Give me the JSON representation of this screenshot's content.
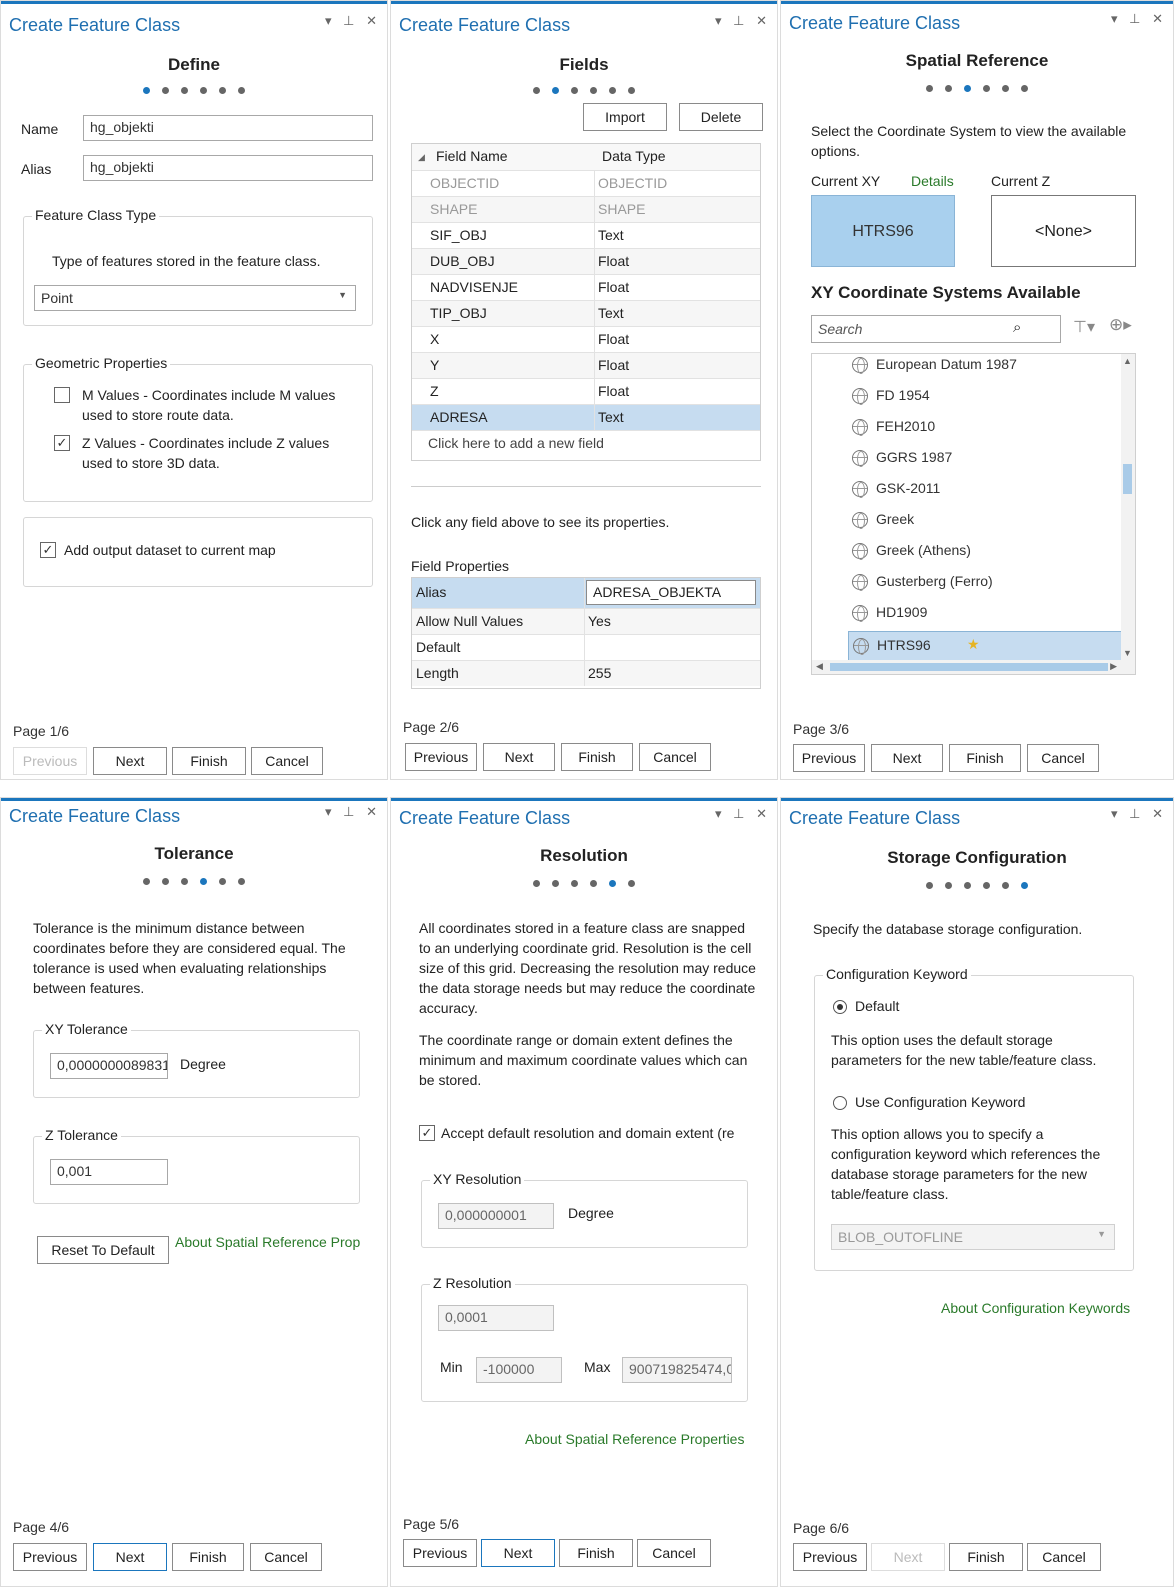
{
  "common": {
    "window_title": "Create Feature Class",
    "pane_controls": "▾ ⊥ ✕",
    "buttons": {
      "previous": "Previous",
      "next": "Next",
      "finish": "Finish",
      "cancel": "Cancel"
    }
  },
  "define": {
    "step": "Define",
    "page": "Page 1/6",
    "name_label": "Name",
    "name_value": "hg_objekti",
    "alias_label": "Alias",
    "alias_value": "hg_objekti",
    "type_group": "Feature Class Type",
    "type_desc": "Type of features stored in the feature class.",
    "type_value": "Point",
    "geom_group": "Geometric Properties",
    "m_values": "M Values - Coordinates include M values used to store route data.",
    "m_checked": false,
    "z_values": "Z Values - Coordinates include Z values used to store 3D data.",
    "z_checked": true,
    "add_output": "Add output dataset to current map",
    "add_checked": true
  },
  "fields": {
    "step": "Fields",
    "page": "Page 2/6",
    "import_btn": "Import",
    "delete_btn": "Delete",
    "col_name": "Field Name",
    "col_type": "Data Type",
    "rows": [
      {
        "name": "OBJECTID",
        "type": "OBJECTID"
      },
      {
        "name": "SHAPE",
        "type": "SHAPE"
      },
      {
        "name": "SIF_OBJ",
        "type": "Text"
      },
      {
        "name": "DUB_OBJ",
        "type": "Float"
      },
      {
        "name": "NADVISENJE",
        "type": "Float"
      },
      {
        "name": "TIP_OBJ",
        "type": "Text"
      },
      {
        "name": "X",
        "type": "Float"
      },
      {
        "name": "Y",
        "type": "Float"
      },
      {
        "name": "Z",
        "type": "Float"
      },
      {
        "name": "ADRESA",
        "type": "Text"
      }
    ],
    "add_field": "Click here to add a new field",
    "hint": "Click any field above to see its properties.",
    "props_title": "Field Properties",
    "props": [
      {
        "key": "Alias",
        "value": "ADRESA_OBJEKTA"
      },
      {
        "key": "Allow Null Values",
        "value": "Yes"
      },
      {
        "key": "Default",
        "value": ""
      },
      {
        "key": "Length",
        "value": "255"
      }
    ]
  },
  "spatial": {
    "step": "Spatial Reference",
    "page": "Page 3/6",
    "desc": "Select the Coordinate System to view the available options.",
    "current_xy": "Current XY",
    "details": "Details",
    "current_z": "Current Z",
    "xy_value": "HTRS96",
    "z_value": "<None>",
    "available": "XY Coordinate Systems Available",
    "search_placeholder": "Search",
    "systems": [
      "European Datum 1987",
      "FD 1954",
      "FEH2010",
      "GGRS 1987",
      "GSK-2011",
      "Greek",
      "Greek (Athens)",
      "Gusterberg (Ferro)",
      "HD1909",
      "HTRS96"
    ]
  },
  "tolerance": {
    "step": "Tolerance",
    "page": "Page 4/6",
    "desc": "Tolerance is the minimum distance between coordinates before they are considered equal. The tolerance is used when evaluating relationships between features.",
    "xy_group": "XY Tolerance",
    "xy_value": "0,0000000089831",
    "xy_unit": "Degree",
    "z_group": "Z Tolerance",
    "z_value": "0,001",
    "reset": "Reset To Default",
    "about": "About Spatial Reference Prop"
  },
  "resolution": {
    "step": "Resolution",
    "page": "Page 5/6",
    "desc1": "All coordinates stored in a feature class are snapped to an underlying coordinate grid. Resolution is the cell size of this grid. Decreasing the resolution may reduce the data storage needs but may reduce the coordinate accuracy.",
    "desc2": "The coordinate range or domain extent defines the minimum and maximum coordinate values which can be stored.",
    "accept": "Accept default resolution and domain extent (re",
    "accept_checked": true,
    "xy_group": "XY Resolution",
    "xy_value": "0,000000001",
    "xy_unit": "Degree",
    "z_group": "Z Resolution",
    "z_value": "0,0001",
    "min_label": "Min",
    "min_value": "-100000",
    "max_label": "Max",
    "max_value": "900719825474,0",
    "about": "About Spatial Reference Properties"
  },
  "storage": {
    "step": "Storage Configuration",
    "page": "Page 6/6",
    "desc": "Specify the database storage configuration.",
    "group": "Configuration Keyword",
    "default_label": "Default",
    "default_desc": "This option uses the default storage parameters for the new table/feature class.",
    "keyword_label": "Use Configuration Keyword",
    "keyword_desc": "This option allows you to specify a configuration keyword which references the database storage parameters for the new table/feature class.",
    "keyword_value": "BLOB_OUTOFLINE",
    "about": "About Configuration Keywords"
  },
  "colors": {
    "accent": "#1b76bd",
    "link": "#2a7a2a",
    "selection": "#c6dcf0"
  }
}
